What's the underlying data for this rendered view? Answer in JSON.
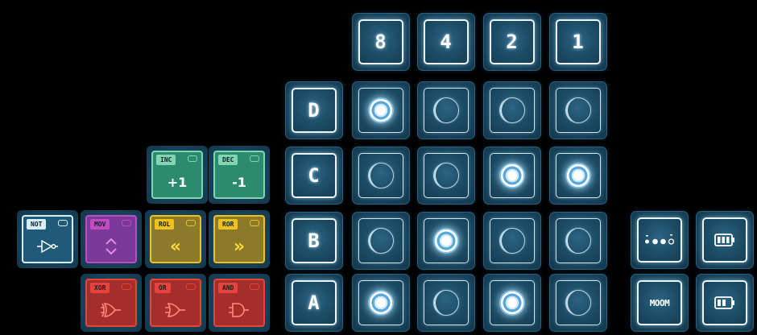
{
  "bit_headers": [
    "8",
    "4",
    "2",
    "1"
  ],
  "registers": [
    {
      "name": "D",
      "bits": [
        true,
        false,
        false,
        false
      ]
    },
    {
      "name": "C",
      "bits": [
        false,
        false,
        true,
        true
      ]
    },
    {
      "name": "B",
      "bits": [
        false,
        true,
        false,
        false
      ]
    },
    {
      "name": "A",
      "bits": [
        true,
        false,
        true,
        false
      ]
    }
  ],
  "instructions": {
    "inc": {
      "tag": "INC",
      "symbol": "+1",
      "color": "#7fd6b0"
    },
    "dec": {
      "tag": "DEC",
      "symbol": "-1",
      "color": "#7fd6b0"
    },
    "not": {
      "tag": "NOT",
      "symbol": "not-gate-icon",
      "color": "#d8eef8"
    },
    "mov": {
      "tag": "MOV",
      "symbol": "up-down-arrows-icon",
      "color": "#c24bc4"
    },
    "rol": {
      "tag": "ROL",
      "symbol": "«",
      "color": "#f2c21c"
    },
    "ror": {
      "tag": "ROR",
      "symbol": "»",
      "color": "#f2c21c"
    },
    "xor": {
      "tag": "XOR",
      "symbol": "xor-gate-icon",
      "color": "#e8433a"
    },
    "or": {
      "tag": "OR",
      "symbol": "or-gate-icon",
      "color": "#e8433a"
    },
    "and": {
      "tag": "AND",
      "symbol": "and-gate-icon",
      "color": "#e8433a"
    }
  },
  "devices": {
    "mode_label": "MOOM",
    "stepper_icon": "dots-progress-icon",
    "battery_full_icon": "battery-full-icon",
    "battery_low_icon": "battery-low-icon"
  }
}
